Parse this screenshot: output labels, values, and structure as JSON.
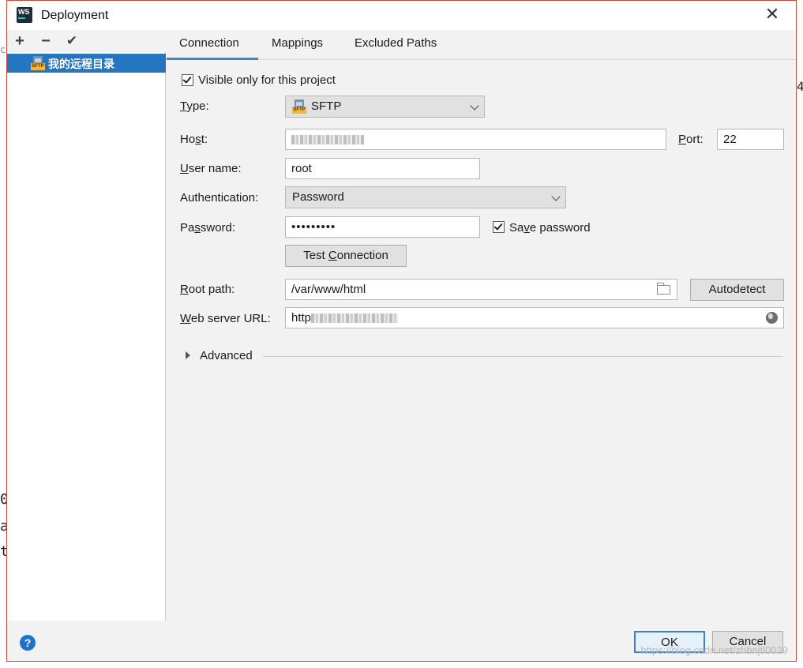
{
  "window": {
    "title": "Deployment",
    "app_icon_text": "WS",
    "close_glyph": "✕"
  },
  "background": {
    "glyphs": [
      "c",
      "4",
      "0",
      "a",
      "t"
    ]
  },
  "toolbar": {
    "add": "+",
    "remove": "−",
    "apply": "✔"
  },
  "servers": [
    {
      "name": "我的远程目录",
      "icon_tag": "SFTP"
    }
  ],
  "tabs": [
    {
      "label": "Connection"
    },
    {
      "label": "Mappings"
    },
    {
      "label": "Excluded Paths"
    }
  ],
  "connection": {
    "visible_only": {
      "label": "Visible only for this project",
      "checked": true
    },
    "type": {
      "label_prefix": "",
      "label_key": "T",
      "label_rest": "ype:",
      "value": "SFTP",
      "icon_tag": "SFTP"
    },
    "host": {
      "label_pre": "Ho",
      "label_key": "s",
      "label_rest": "t:"
    },
    "port": {
      "label_key": "P",
      "label_rest": "ort:",
      "value": "22"
    },
    "username": {
      "label_key": "U",
      "label_rest": "ser name:",
      "value": "root"
    },
    "authentication": {
      "label": "Authentication:",
      "value": "Password"
    },
    "password": {
      "label_pre": "Pa",
      "label_key": "s",
      "label_rest": "sword:",
      "value": "•••••••••"
    },
    "save_password": {
      "label_pre": "Sa",
      "label_key": "v",
      "label_rest": "e password",
      "checked": true
    },
    "test_connection": {
      "label_pre": "Test ",
      "label_key": "C",
      "label_rest": "onnection"
    },
    "root_path": {
      "label_key": "R",
      "label_rest": "oot path:",
      "value": "/var/www/html"
    },
    "autodetect": {
      "label": "Autodetect"
    },
    "web_url": {
      "label_key": "W",
      "label_rest": "eb server URL:",
      "value_prefix": "http"
    },
    "advanced": {
      "label": "Advanced"
    }
  },
  "footer": {
    "help": "?",
    "ok": "OK",
    "cancel": "Cancel",
    "watermark": "https://blog.csdn.net/zhbnjtl0039"
  }
}
